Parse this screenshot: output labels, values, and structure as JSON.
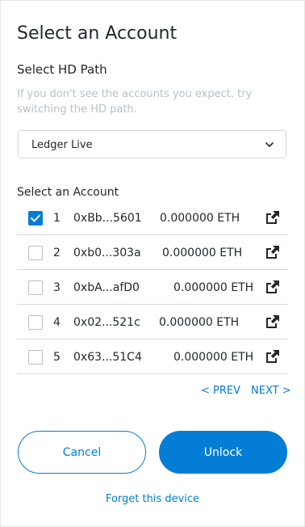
{
  "page": {
    "title": "Select an Account"
  },
  "hd_path": {
    "label": "Select HD Path",
    "hint": "If you don't see the accounts you expect, try switching the HD path.",
    "selected": "Ledger Live"
  },
  "accounts": {
    "label": "Select an Account",
    "items": [
      {
        "index": "1",
        "address": "0xBb...5601",
        "balance": "0.000000 ETH",
        "checked": true
      },
      {
        "index": "2",
        "address": "0xb0...303a",
        "balance": "0.000000 ETH",
        "checked": false
      },
      {
        "index": "3",
        "address": "0xbA...afD0",
        "balance": "0.000000 ETH",
        "checked": false
      },
      {
        "index": "4",
        "address": "0x02...521c",
        "balance": "0.000000 ETH",
        "checked": false
      },
      {
        "index": "5",
        "address": "0x63...51C4",
        "balance": "0.000000 ETH",
        "checked": false
      }
    ]
  },
  "pagination": {
    "prev": "< PREV",
    "next": "NEXT >"
  },
  "actions": {
    "cancel": "Cancel",
    "unlock": "Unlock",
    "forget": "Forget this device"
  },
  "colors": {
    "accent": "#037dd6",
    "hint": "#bbc0c5",
    "text": "#24272a"
  },
  "icons": {
    "dropdown": "chevron-down-icon",
    "external": "external-link-icon",
    "check": "check-icon"
  }
}
